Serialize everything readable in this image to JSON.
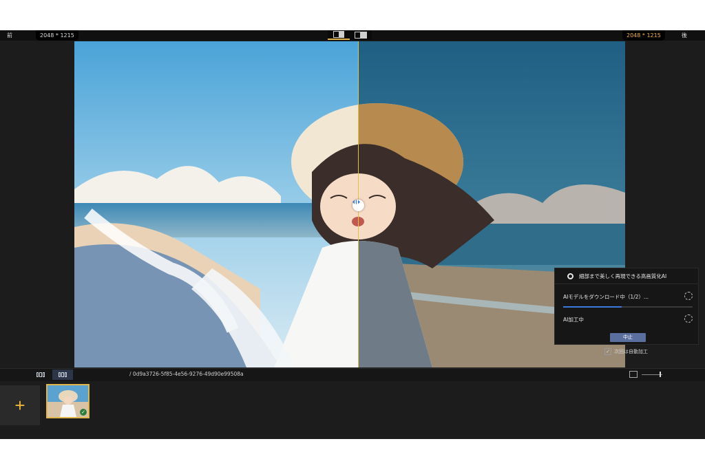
{
  "topbar": {
    "before_label": "前",
    "after_label": "後",
    "dimensions_left": "2048 * 1215",
    "dimensions_right": "2048 * 1215",
    "accent_color": "#f3b23a"
  },
  "panel": {
    "title": "細部まで美しく再現できる高画質化AI",
    "step1_label": "AIモデルをダウンロード中（1/2）...",
    "step1_progress": 0.45,
    "step2_label": "AI加工中",
    "stop_button": "中止",
    "auto_process_label": "次回は自動加工"
  },
  "strip": {
    "path_text": "/ 0d9a3726-5f85-4e56-9276-49d90e99508a"
  },
  "thumbnails": {
    "add_label": "+",
    "check_mark": "✓"
  }
}
